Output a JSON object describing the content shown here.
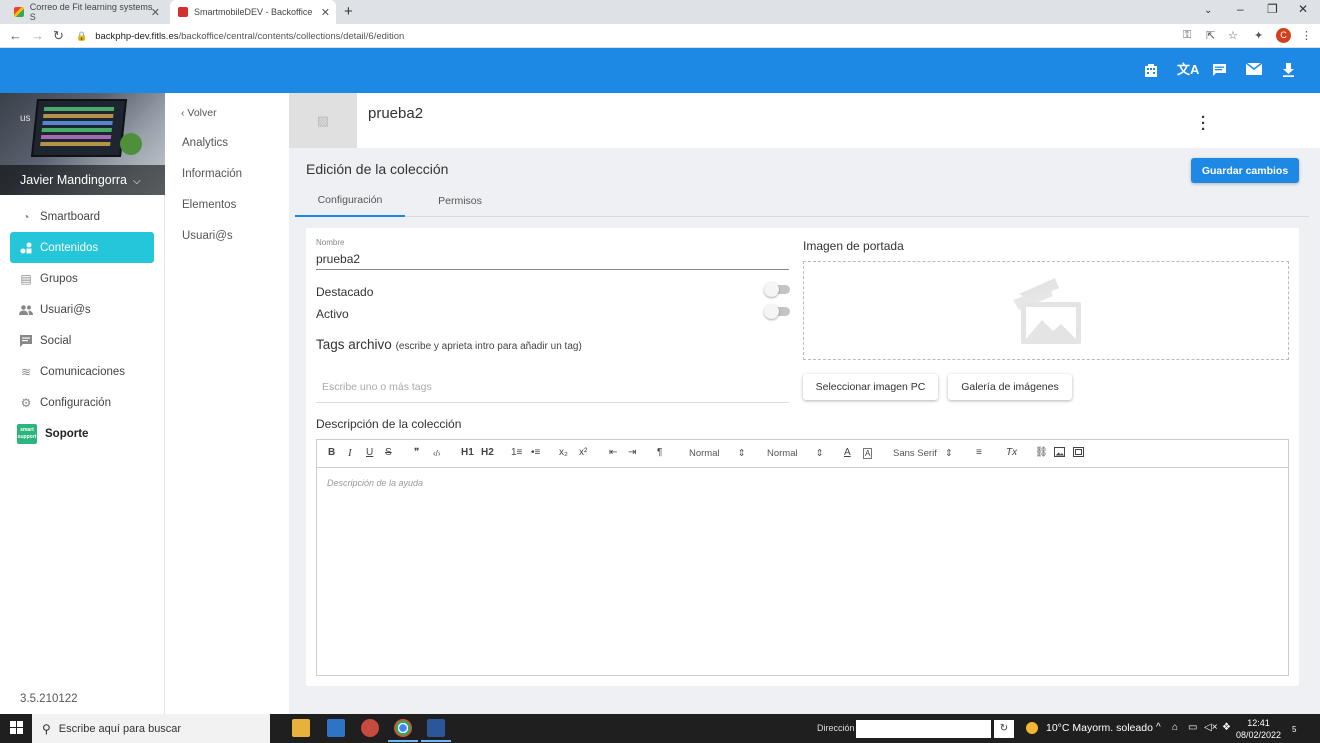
{
  "browser": {
    "tabs": [
      {
        "title": "Correo de Fit learning systems S",
        "active": false,
        "icon": "gmail-icon"
      },
      {
        "title": "SmartmobileDEV - Backoffice",
        "active": true,
        "icon": "smartmobile-favicon"
      }
    ],
    "new_tab": "+",
    "url_host": "backphp-dev.fitls.es",
    "url_path": "/backoffice/central/contents/collections/detail/6/edition",
    "profile_initial": "C"
  },
  "appbar": {
    "icons": [
      "building-icon",
      "translate-icon",
      "chat-icon",
      "mail-icon",
      "download-icon"
    ],
    "color": "#1e88e5"
  },
  "sidebar": {
    "user_name": "Javier Mandingorra",
    "broken_image_alt": "us",
    "items": [
      {
        "label": "Smartboard",
        "icon": "dashboard-icon",
        "active": false
      },
      {
        "label": "Contenidos",
        "icon": "content-icon",
        "active": true
      },
      {
        "label": "Grupos",
        "icon": "groups-icon",
        "active": false
      },
      {
        "label": "Usuari@s",
        "icon": "users-icon",
        "active": false
      },
      {
        "label": "Social",
        "icon": "social-icon",
        "active": false
      },
      {
        "label": "Comunicaciones",
        "icon": "communications-icon",
        "active": false
      },
      {
        "label": "Configuración",
        "icon": "settings-icon",
        "active": false
      },
      {
        "label": "Soporte",
        "icon": "smart-support-logo",
        "active": false
      }
    ],
    "soporte_logo_text": "smart support",
    "version": "3.5.210122",
    "active_color": "#26c6da"
  },
  "subnav": {
    "back_label": "Volver",
    "items": [
      "Analytics",
      "Información",
      "Elementos",
      "Usuari@s"
    ]
  },
  "main": {
    "collection_name": "prueba2",
    "edit_title": "Edición de la colección",
    "save_button": "Guardar cambios",
    "tabs": [
      {
        "label": "Configuración",
        "active": true
      },
      {
        "label": "Permisos",
        "active": false
      }
    ],
    "form": {
      "name_label": "Nombre",
      "name_value": "prueba2",
      "destacado_label": "Destacado",
      "destacado_on": false,
      "activo_label": "Activo",
      "activo_on": false,
      "tags_title": "Tags archivo",
      "tags_hint": "(escribe y aprieta intro para añadir un tag)",
      "tags_placeholder": "Escribe uno o más tags",
      "cover_title": "Imagen de portada",
      "select_image_button": "Seleccionar imagen PC",
      "gallery_button": "Galería de imágenes",
      "description_title": "Descripción de la colección",
      "description_placeholder": "Descripción de la ayuda"
    },
    "editor_toolbar": {
      "bold": "B",
      "italic": "I",
      "underline": "U",
      "strike": "S",
      "quote": "❞",
      "code": "‹/›",
      "h1": "H1",
      "h2": "H2",
      "ol": "1≡",
      "ul": "•≡",
      "sub": "x₂",
      "sup": "x²",
      "outdent": "⇤",
      "indent": "⇥",
      "direction": "¶",
      "size_select": "Normal",
      "header_select": "Normal",
      "color": "A",
      "background": "A",
      "font_select": "Sans Serif",
      "align": "≡",
      "clean": "Tx"
    }
  },
  "taskbar": {
    "search_placeholder": "Escribe aquí para buscar",
    "direccion_label": "Dirección",
    "weather": "10°C  Mayorm. soleado",
    "time": "12:41",
    "date": "08/02/2022",
    "notifications": "5"
  }
}
